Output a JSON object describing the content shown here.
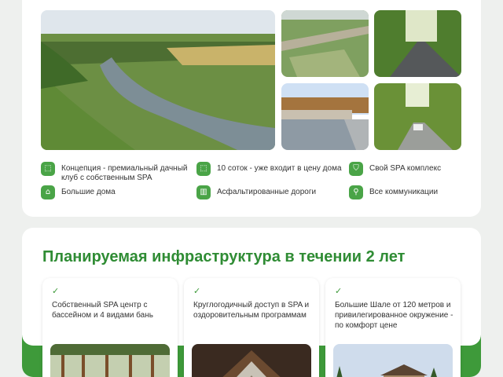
{
  "features": [
    {
      "icon": "concept-icon",
      "text": "Концепция - премиальный дачный клуб с собственным SPA"
    },
    {
      "icon": "land-icon",
      "text": "10 соток - уже входит в цену дома"
    },
    {
      "icon": "shield-icon",
      "text": "Свой SPA комплекс"
    },
    {
      "icon": "house-icon",
      "text": "Большие дома"
    },
    {
      "icon": "road-icon",
      "text": "Асфальтированные дороги"
    },
    {
      "icon": "faucet-icon",
      "text": "Все коммуникации"
    }
  ],
  "infrastructure": {
    "title": "Планируемая инфраструктура в течении 2 лет",
    "cards": [
      {
        "text": "Собственный SPA центр с бассейном и 4 видами бань"
      },
      {
        "text": "Круглогодичный доступ в SPA и оздоровительным программам"
      },
      {
        "text": "Большие Шале от 120 метров и привилегированное окружение - по комфорт цене"
      }
    ]
  },
  "colors": {
    "accent": "#3e9a3a",
    "accent_light": "#4aa447",
    "title": "#2f8c34"
  }
}
